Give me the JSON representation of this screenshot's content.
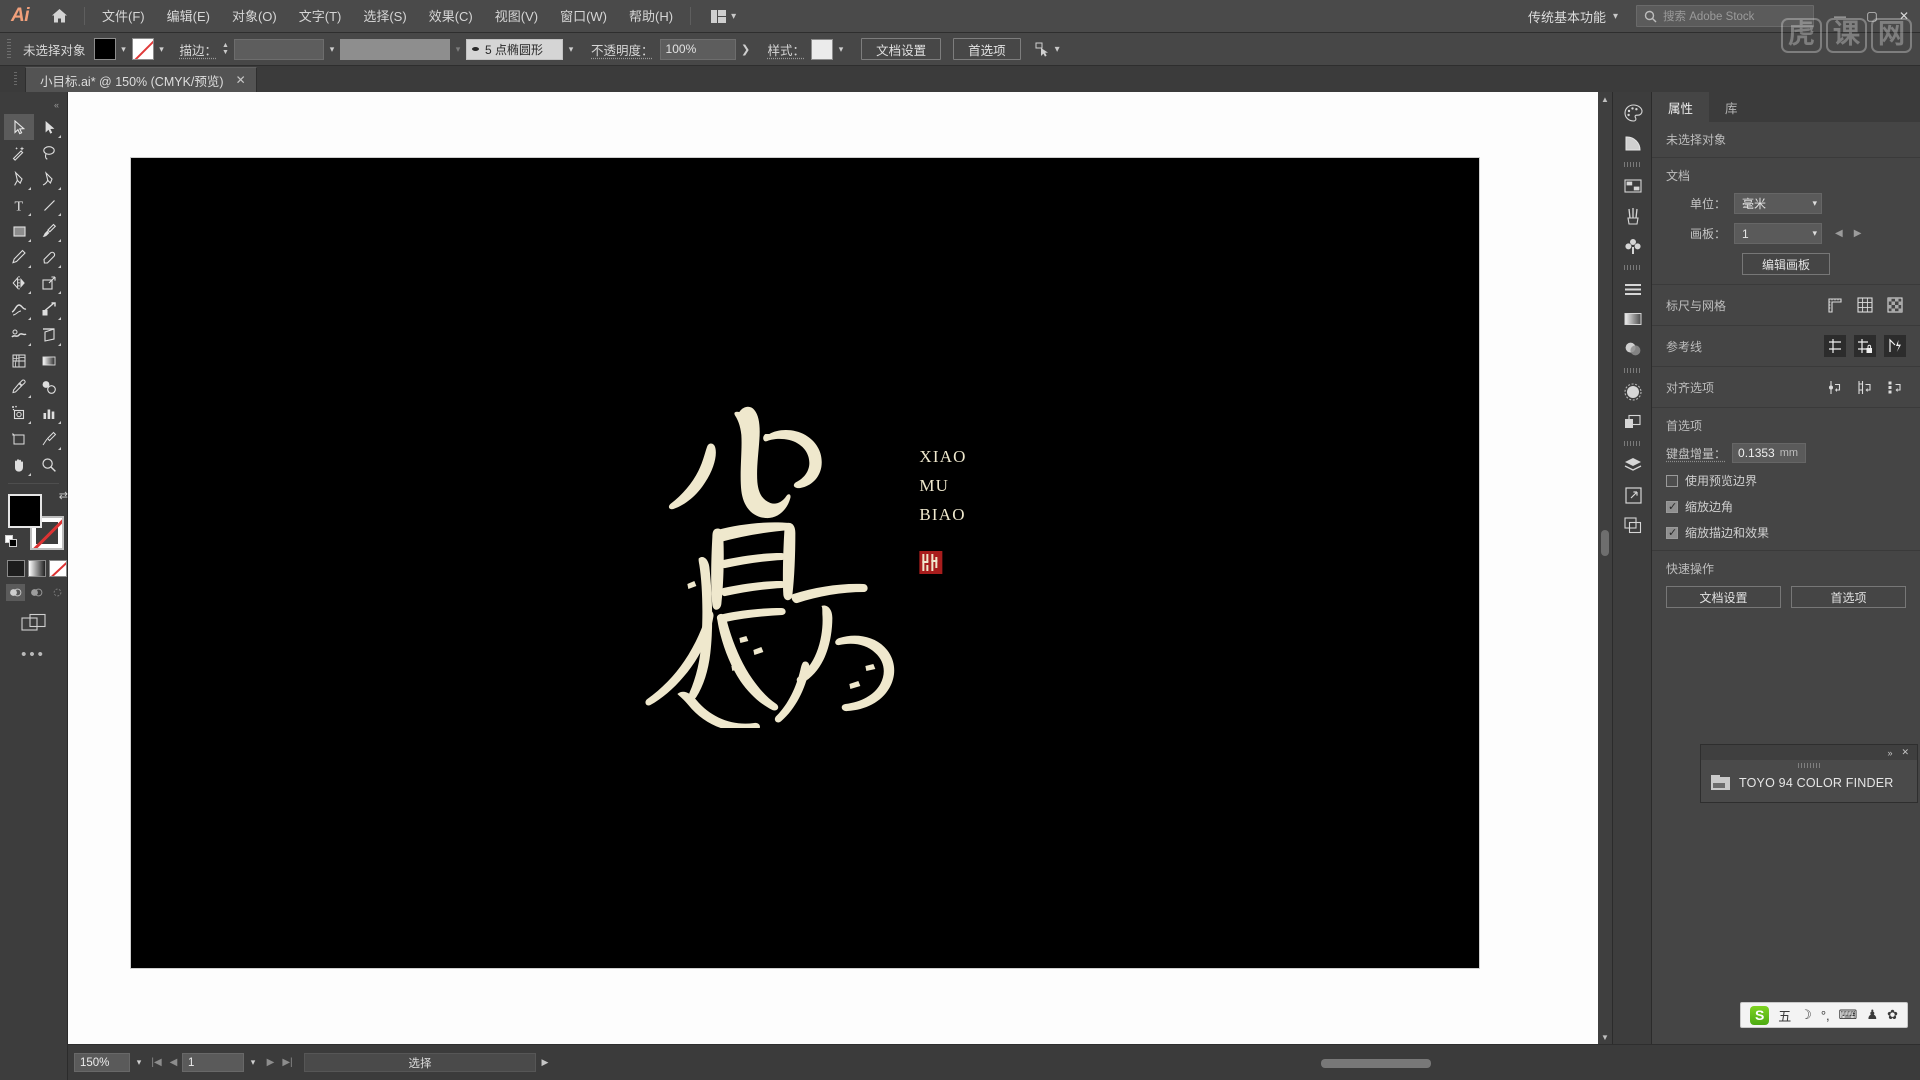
{
  "app": {
    "logo": "Ai",
    "home_icon": "home-icon",
    "workspace": "传统基本功能",
    "stock_search_placeholder": "搜索 Adobe Stock",
    "window_minimize": "—",
    "window_maximize": "▢",
    "window_close": "✕"
  },
  "menu": {
    "items": [
      {
        "label": "文件(F)"
      },
      {
        "label": "编辑(E)"
      },
      {
        "label": "对象(O)"
      },
      {
        "label": "文字(T)"
      },
      {
        "label": "选择(S)"
      },
      {
        "label": "效果(C)"
      },
      {
        "label": "视图(V)"
      },
      {
        "label": "窗口(W)"
      },
      {
        "label": "帮助(H)"
      }
    ]
  },
  "control_bar": {
    "selection_status": "未选择对象",
    "fill_color": "#000000",
    "stroke_color": "none",
    "stroke_label": "描边：",
    "stroke_weight": "",
    "profile_value": "",
    "brush_definition": "5 点椭圆形",
    "opacity_label": "不透明度：",
    "opacity_value": "100%",
    "style_label": "样式：",
    "style_swatch": "#ebebeb",
    "doc_setup_button": "文档设置",
    "preferences_button": "首选项",
    "select_similar_icon": "select-similar-icon"
  },
  "document_tab": {
    "title": "小目标.ai* @ 150% (CMYK/预览)",
    "close_icon": "✕"
  },
  "toolbar": {
    "tools": [
      {
        "name": "selection-tool",
        "active": true
      },
      {
        "name": "direct-selection-tool",
        "active": false
      },
      {
        "name": "magic-wand-tool",
        "active": false
      },
      {
        "name": "lasso-tool",
        "active": false
      },
      {
        "name": "pen-tool",
        "active": false
      },
      {
        "name": "curvature-tool",
        "active": false
      },
      {
        "name": "type-tool",
        "active": false
      },
      {
        "name": "line-segment-tool",
        "active": false
      },
      {
        "name": "rectangle-tool",
        "active": false
      },
      {
        "name": "paintbrush-tool",
        "active": false
      },
      {
        "name": "pencil-tool",
        "active": false
      },
      {
        "name": "eraser-tool",
        "active": false
      },
      {
        "name": "reflect-tool",
        "active": false
      },
      {
        "name": "scale-tool",
        "active": false
      },
      {
        "name": "width-tool",
        "active": false
      },
      {
        "name": "free-transform-tool",
        "active": false
      },
      {
        "name": "shape-builder-tool",
        "active": false
      },
      {
        "name": "perspective-grid-tool",
        "active": false
      },
      {
        "name": "mesh-tool",
        "active": false
      },
      {
        "name": "gradient-tool",
        "active": false
      },
      {
        "name": "eyedropper-tool",
        "active": false
      },
      {
        "name": "blend-tool",
        "active": false
      },
      {
        "name": "symbol-sprayer-tool",
        "active": false
      },
      {
        "name": "column-graph-tool",
        "active": false
      },
      {
        "name": "artboard-tool",
        "active": false
      },
      {
        "name": "slice-tool",
        "active": false
      },
      {
        "name": "hand-tool",
        "active": false
      },
      {
        "name": "zoom-tool",
        "active": false
      }
    ],
    "fill_swatch": "#000000",
    "stroke_swatch": "none",
    "swap_icon": "swap-fill-stroke-icon",
    "default_icon": "default-fill-stroke-icon",
    "color_mode": "color-mode-button",
    "gradient_mode": "gradient-mode-button",
    "none_mode": "none-mode-button",
    "draw_normal": "draw-normal-button",
    "draw_behind": "draw-behind-button",
    "draw_inside": "draw-inside-button",
    "screen_mode": "change-screen-mode-button",
    "more_tools": "•••"
  },
  "canvas": {
    "artboard_background": "#000000",
    "artwork": {
      "calligraphy_text": "小目标",
      "latin_lines": [
        "XIAO",
        "MU",
        "BIAO"
      ],
      "ink_color": "#efe8cd",
      "seal_color": "#a81d1d"
    }
  },
  "dock_rail": {
    "items": [
      {
        "name": "color-panel-icon"
      },
      {
        "name": "color-guide-panel-icon"
      },
      {
        "name": "swatches-panel-icon"
      },
      {
        "name": "brushes-panel-icon"
      },
      {
        "name": "symbols-panel-icon"
      },
      {
        "name": "align-panel-icon"
      },
      {
        "name": "gradient-panel-icon"
      },
      {
        "name": "transparency-panel-icon"
      },
      {
        "name": "appearance-panel-icon"
      },
      {
        "name": "pathfinder-panel-icon"
      },
      {
        "name": "layers-panel-icon"
      },
      {
        "name": "artboards-panel-icon"
      },
      {
        "name": "asset-export-panel-icon"
      }
    ]
  },
  "properties_panel": {
    "tabs": [
      {
        "label": "属性",
        "active": true
      },
      {
        "label": "库",
        "active": false
      }
    ],
    "selection_state": "未选择对象",
    "document": {
      "title": "文档",
      "units_label": "单位：",
      "units_value": "毫米",
      "artboard_label": "画板：",
      "artboard_value": "1",
      "edit_artboards_button": "编辑画板"
    },
    "rulers_grids": {
      "title": "标尺与网格",
      "icons": [
        "show-rulers-icon",
        "show-grid-icon",
        "show-transparency-grid-icon"
      ]
    },
    "guides": {
      "title": "参考线",
      "icons": [
        "show-guides-icon",
        "lock-guides-icon",
        "smart-guides-icon"
      ]
    },
    "snap_options": {
      "title": "对齐选项",
      "icons": [
        "snap-to-point-icon",
        "snap-to-grid-icon",
        "snap-to-pixel-icon"
      ]
    },
    "preferences": {
      "title": "首选项",
      "keyboard_increment_label": "键盘增量：",
      "keyboard_increment_value": "0.1353",
      "keyboard_increment_unit": "mm",
      "checkboxes": [
        {
          "label": "使用预览边界",
          "checked": false
        },
        {
          "label": "缩放边角",
          "checked": true
        },
        {
          "label": "缩放描边和效果",
          "checked": true
        }
      ]
    },
    "quick_actions": {
      "title": "快速操作",
      "buttons": [
        "文档设置",
        "首选项"
      ]
    }
  },
  "toyo_popup": {
    "name": "TOYO 94 COLOR FINDER",
    "collapse_icon": "»",
    "close_icon": "✕",
    "folder_icon": "folder-icon"
  },
  "ime_bar": {
    "logo": "S",
    "items": [
      "五",
      "☽",
      "°,",
      "⌨",
      "♟",
      "✿"
    ]
  },
  "status_bar": {
    "zoom_value": "150%",
    "page_value": "1",
    "status_text": "选择",
    "first_icon": "first-artboard-icon",
    "prev_icon": "prev-artboard-icon",
    "next_icon": "next-artboard-icon",
    "last_icon": "last-artboard-icon",
    "expand_icon": "▶"
  },
  "watermark": {
    "chars": [
      "虎",
      "课",
      "网"
    ]
  }
}
